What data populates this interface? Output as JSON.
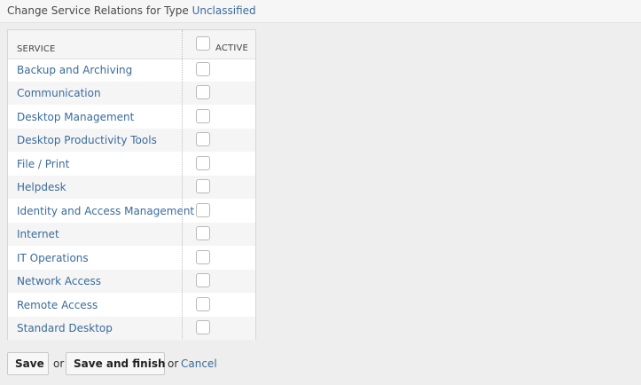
{
  "header": {
    "title_prefix": "Change Service Relations for Type",
    "type_name": "Unclassified"
  },
  "table": {
    "col_service": "SERVICE",
    "col_active": "ACTIVE",
    "rows": [
      {
        "label": "Backup and Archiving",
        "checked": false
      },
      {
        "label": "Communication",
        "checked": false
      },
      {
        "label": "Desktop Management",
        "checked": false
      },
      {
        "label": "Desktop Productivity Tools",
        "checked": false
      },
      {
        "label": "File / Print",
        "checked": false
      },
      {
        "label": "Helpdesk",
        "checked": false
      },
      {
        "label": "Identity and Access Management",
        "checked": false
      },
      {
        "label": "Internet",
        "checked": false
      },
      {
        "label": "IT Operations",
        "checked": false
      },
      {
        "label": "Network Access",
        "checked": false
      },
      {
        "label": "Remote Access",
        "checked": false
      },
      {
        "label": "Standard Desktop",
        "checked": false
      }
    ]
  },
  "actions": {
    "save_label": "Save",
    "or_label": "or",
    "save_finish_label": "Save and finish",
    "cancel_label": "Cancel"
  }
}
